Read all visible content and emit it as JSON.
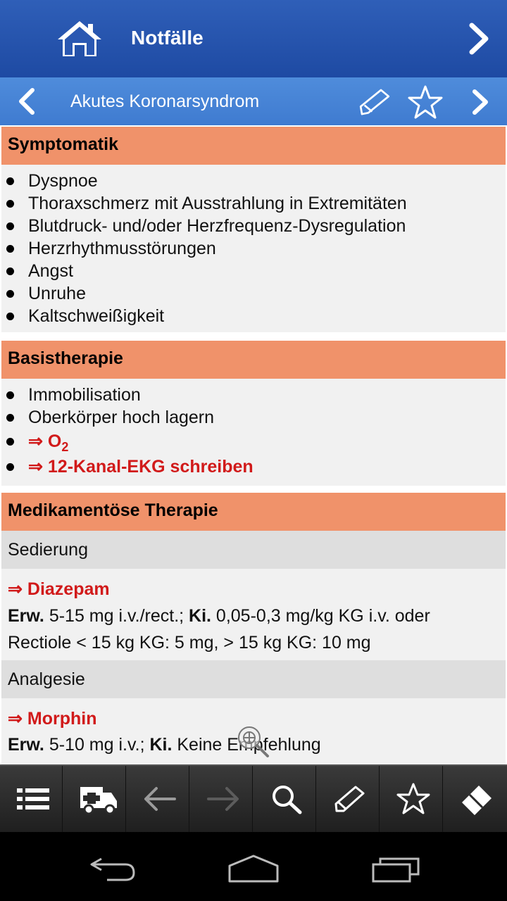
{
  "header": {
    "title": "Notfälle",
    "home_icon": "home-icon",
    "next_icon": "chevron-right-icon"
  },
  "subheader": {
    "title": "Akutes Koronarsyndrom",
    "back_icon": "chevron-left-icon",
    "edit_icon": "pencil-icon",
    "favorite_icon": "star-icon",
    "next_icon": "chevron-right-icon"
  },
  "sections": {
    "symptomatik": {
      "title": "Symptomatik",
      "items": [
        "Dyspnoe",
        "Thoraxschmerz mit Ausstrahlung in Extremitäten",
        "Blutdruck- und/oder Herzfrequenz-Dysregulation",
        "Herzrhythmusstörungen",
        "Angst",
        "Unruhe",
        "Kaltschweißigkeit"
      ]
    },
    "basistherapie": {
      "title": "Basistherapie",
      "items": [
        "Immobilisation",
        "Oberkörper hoch lagern"
      ],
      "links": [
        "⇒ O",
        "⇒ 12-Kanal-EKG schreiben"
      ],
      "o2_subscript": "2"
    },
    "medikamentoese": {
      "title": "Medikamentöse Therapie",
      "subsections": [
        {
          "title": "Sedierung",
          "drug": "⇒ Diazepam",
          "erw_label": "Erw.",
          "erw_text": " 5-15 mg i.v./rect.; ",
          "ki_label": "Ki.",
          "ki_text": " 0,05-0,3 mg/kg KG i.v. oder",
          "line2": "Rectiole < 15 kg KG: 5 mg, > 15 kg KG: 10 mg"
        },
        {
          "title": "Analgesie",
          "drug": "⇒ Morphin",
          "erw_label": "Erw.",
          "erw_text": " 5-10 mg i.v.; ",
          "ki_label": "Ki.",
          "ki_text": " Keine Empfehlung"
        }
      ]
    }
  },
  "toolbar": {
    "items": [
      "list-icon",
      "ambulance-icon",
      "back-arrow-icon",
      "forward-arrow-icon",
      "search-icon",
      "pencil-icon",
      "star-icon",
      "eraser-icon"
    ]
  },
  "navbar": {
    "items": [
      "back-icon",
      "home-icon",
      "recent-apps-icon"
    ]
  },
  "colors": {
    "section_header": "#f0926a",
    "topbar": "#1e4aa3",
    "subbar": "#4a86d6",
    "link_red": "#d11a1a"
  }
}
